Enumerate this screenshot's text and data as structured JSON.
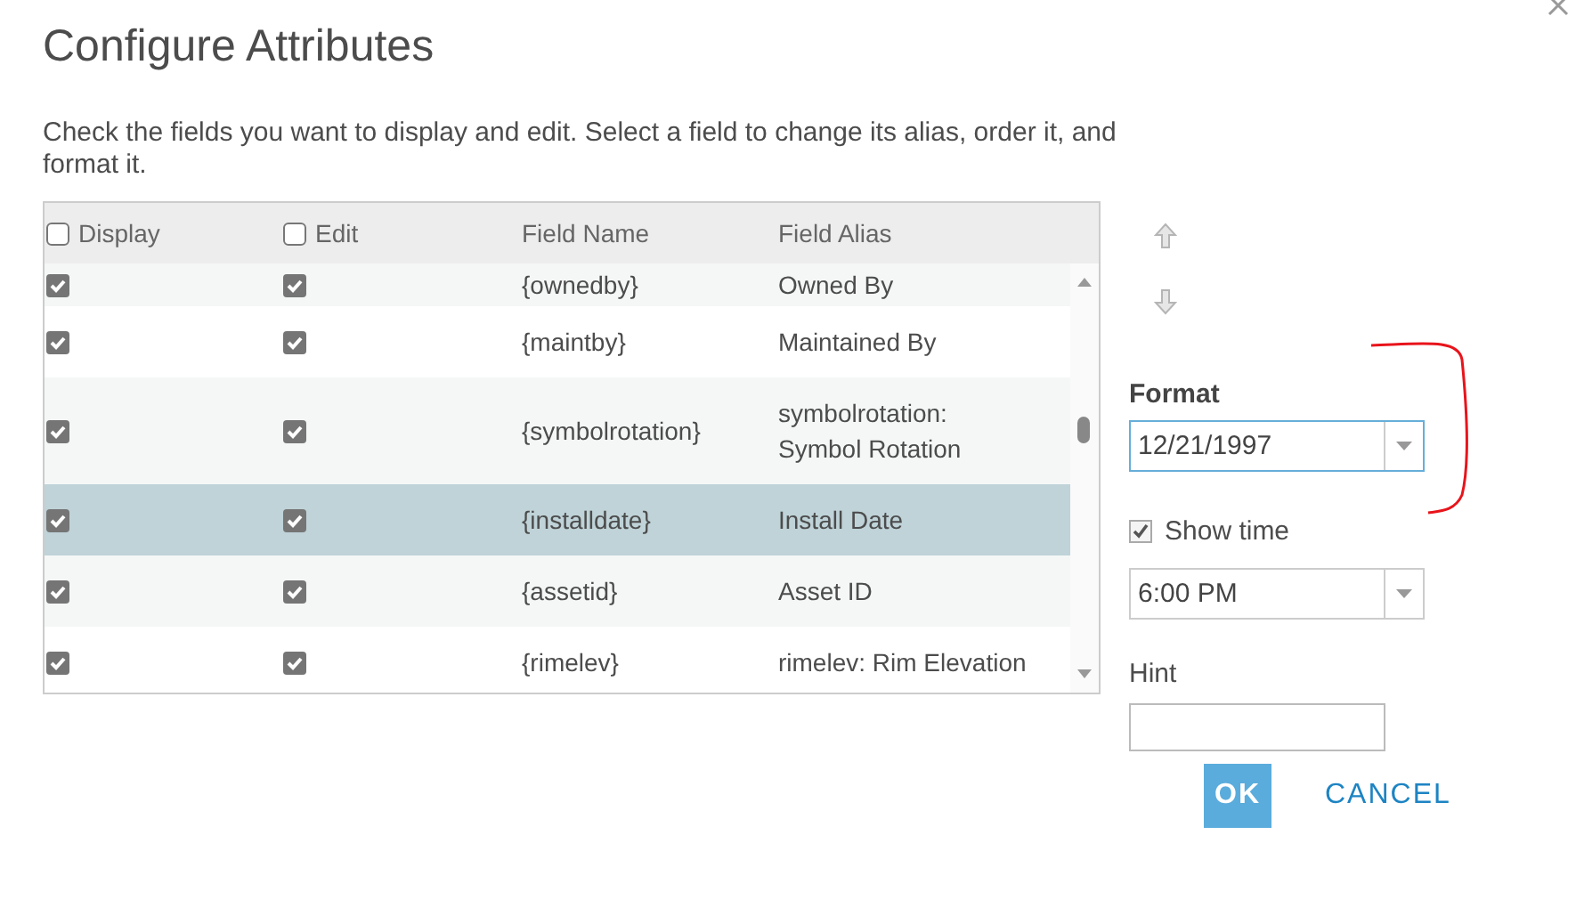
{
  "dialog": {
    "title": "Configure Attributes",
    "description": "Check the fields you want to display and edit. Select a field to change its alias, order it, and format it."
  },
  "table": {
    "columns": [
      {
        "label": "Display",
        "kind": "checkbox",
        "checked": false
      },
      {
        "label": "Edit",
        "kind": "checkbox",
        "checked": false
      },
      {
        "label": "Field Name",
        "kind": "text"
      },
      {
        "label": "Field Alias",
        "kind": "text"
      }
    ],
    "rows": [
      {
        "display": true,
        "edit": true,
        "field_name": "{ownedby}",
        "alias": "Owned By",
        "selected": false
      },
      {
        "display": true,
        "edit": true,
        "field_name": "{maintby}",
        "alias": "Maintained By",
        "selected": false
      },
      {
        "display": true,
        "edit": true,
        "field_name": "{symbolrotation}",
        "alias": "symbolrotation: Symbol Rotation",
        "selected": false
      },
      {
        "display": true,
        "edit": true,
        "field_name": "{installdate}",
        "alias": "Install Date",
        "selected": true
      },
      {
        "display": true,
        "edit": true,
        "field_name": "{assetid}",
        "alias": "Asset ID",
        "selected": false
      },
      {
        "display": true,
        "edit": true,
        "field_name": "{rimelev}",
        "alias": "rimelev: Rim Elevation",
        "selected": false
      }
    ]
  },
  "format": {
    "label": "Format",
    "value": "12/21/1997"
  },
  "show_time": {
    "label": "Show time",
    "checked": true
  },
  "time": {
    "value": "6:00 PM"
  },
  "hint": {
    "label": "Hint"
  },
  "buttons": [
    {
      "label": "OK",
      "kind": "primary"
    },
    {
      "label": "CANCEL",
      "kind": "secondary"
    }
  ]
}
